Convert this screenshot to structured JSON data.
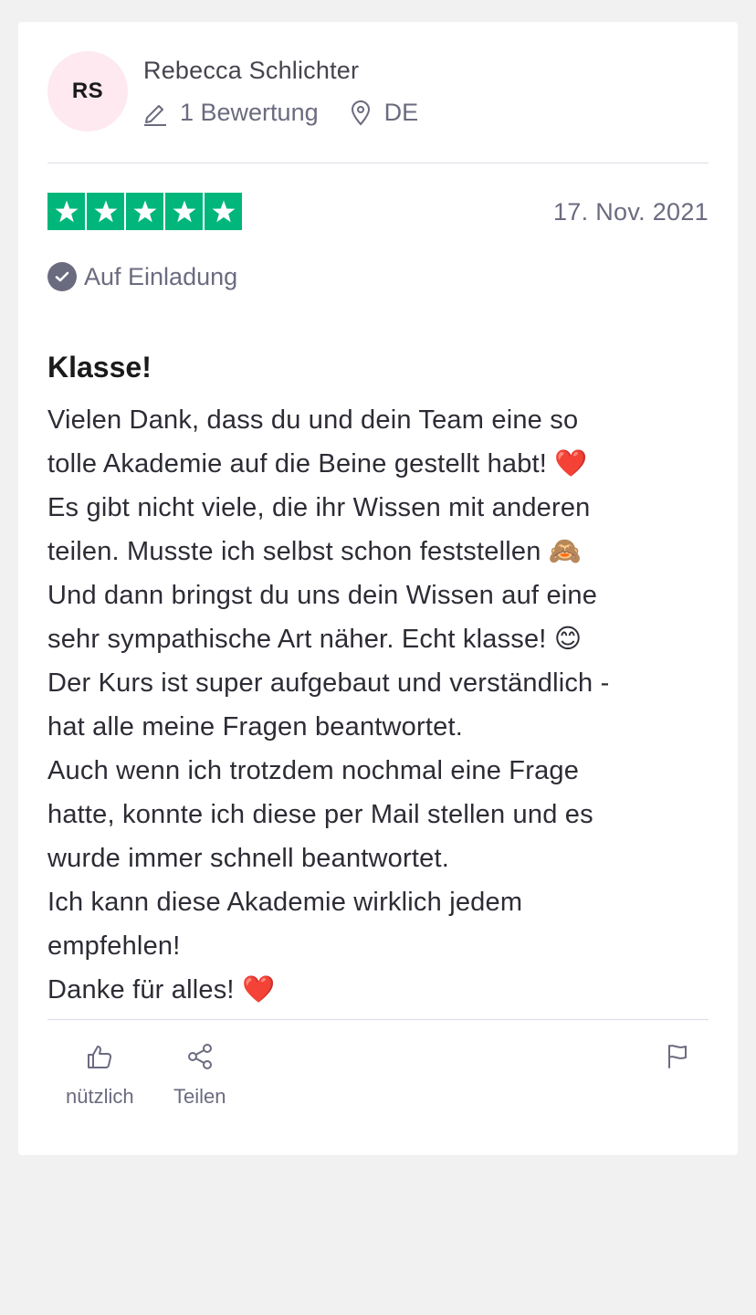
{
  "reviewer": {
    "initials": "RS",
    "name": "Rebecca Schlichter",
    "reviews_count": "1 Bewertung",
    "country": "DE"
  },
  "review": {
    "rating": 5,
    "max_rating": 5,
    "date": "17. Nov. 2021",
    "verified_label": "Auf Einladung",
    "title": "Klasse!",
    "body_lines": [
      "Vielen Dank, dass du und dein Team eine so",
      "tolle Akademie auf die Beine gestellt habt! ❤️",
      "Es gibt nicht viele, die ihr Wissen mit anderen",
      "teilen. Musste ich selbst schon feststellen 🙈",
      "Und dann bringst du uns dein Wissen auf eine",
      "sehr sympathische Art näher. Echt klasse! 😊",
      "Der Kurs ist super aufgebaut und verständlich -",
      "hat alle meine Fragen beantwortet.",
      "Auch wenn ich trotzdem nochmal eine Frage",
      "hatte, konnte ich diese per Mail stellen und es",
      "wurde immer schnell beantwortet.",
      "Ich kann diese Akademie wirklich jedem",
      "empfehlen!",
      "Danke für alles! ❤️"
    ]
  },
  "actions": {
    "useful_label": "nützlich",
    "share_label": "Teilen"
  },
  "colors": {
    "star_green": "#00b67a",
    "muted_text": "#6b6b80",
    "avatar_bg": "#fde9ef",
    "page_bg": "#f1f1f1"
  },
  "icons": {
    "reviews": "pencil-icon",
    "location": "location-pin-icon",
    "verified": "check-circle-icon",
    "useful": "thumbs-up-icon",
    "share": "share-icon",
    "flag": "flag-icon",
    "star": "star-icon"
  }
}
